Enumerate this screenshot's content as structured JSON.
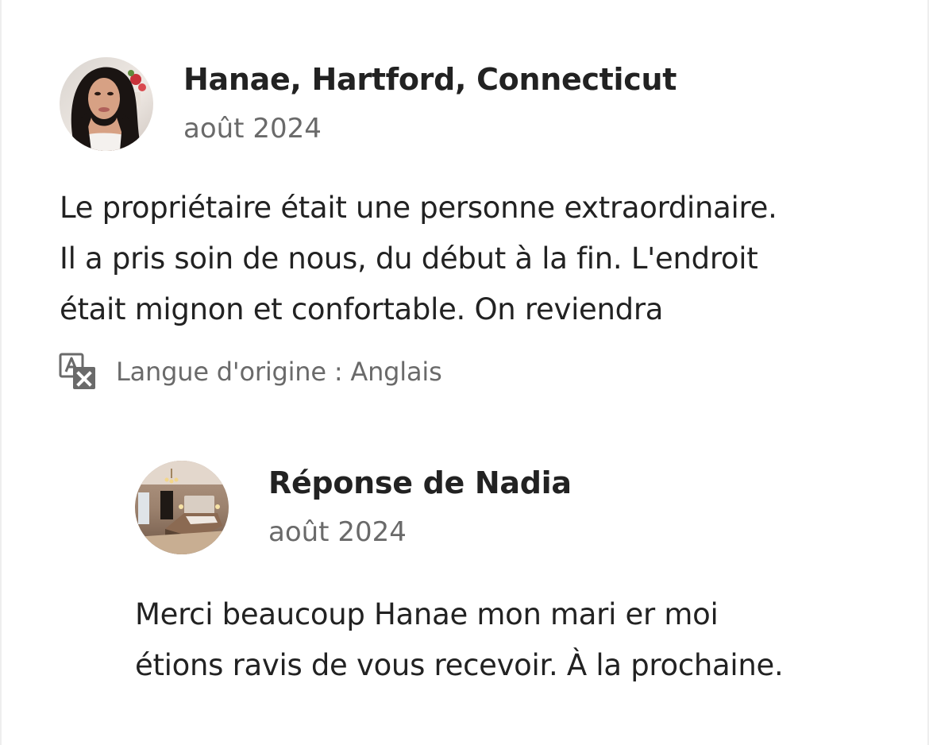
{
  "review": {
    "reviewer_name": "Hanae, Hartford, Connecticut",
    "date": "août 2024",
    "text_lines": [
      "Le propriétaire était une personne extraordinaire.",
      "Il a pris soin de nous, du début à la fin. L'endroit",
      "était mignon et confortable. On reviendra"
    ],
    "original_language": "Langue d'origine : Anglais",
    "translate_icon": "translate-icon"
  },
  "response": {
    "title": "Réponse de Nadia",
    "date": "août 2024",
    "text_lines": [
      "Merci beaucoup Hanae mon mari er moi",
      "étions ravis de vous recevoir. À la prochaine."
    ]
  },
  "colors": {
    "text_primary": "#222222",
    "text_secondary": "#6a6a6a",
    "background": "#ffffff"
  }
}
